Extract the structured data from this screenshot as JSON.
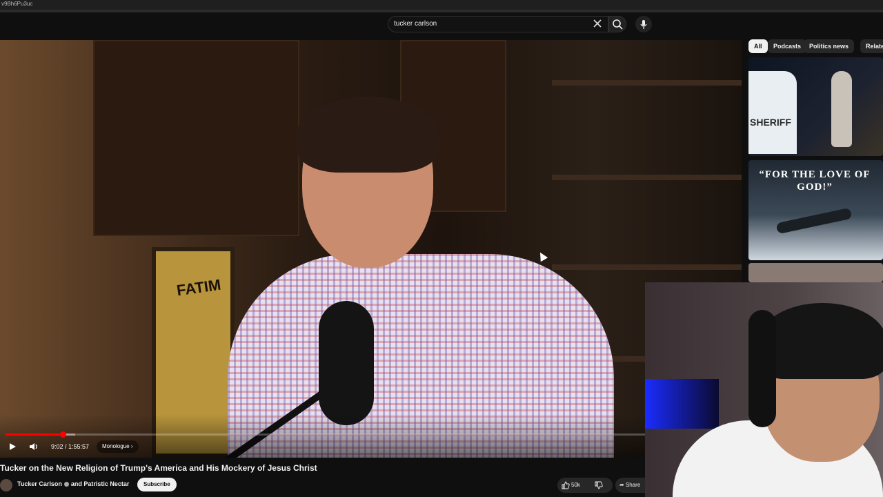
{
  "browser": {
    "url_fragment": "v9Bh6Pu3uc"
  },
  "search": {
    "query": "tucker carlson"
  },
  "player": {
    "time": "9:02 / 1:55:57",
    "chapter": "Monologue",
    "progress_fraction": 0.078,
    "buffer_fraction": 0.095
  },
  "video": {
    "title": "Tucker on the New Religion of Trump's America and His Mockery of Jesus Christ",
    "channel": "Tucker Carlson",
    "collab": "and Patristic Nectar",
    "subscribe_label": "Subscribe",
    "likes": "50k",
    "share_label": "Share"
  },
  "filter_chips": [
    {
      "label": "All",
      "active": true
    },
    {
      "label": "Podcasts",
      "active": false
    },
    {
      "label": "Politics news",
      "active": false
    },
    {
      "label": "Related",
      "active": false
    }
  ],
  "recommendations": [
    {
      "overlay_text": "SHERIFF"
    },
    {
      "overlay_text": "“FOR THE LOVE OF GOD!”"
    },
    {
      "overlay_text": ""
    }
  ],
  "scene": {
    "poster_text": "FATIM"
  },
  "colors": {
    "progress": "#ff0000",
    "background": "#0f0f0f",
    "chip_active": "#f1f1f1"
  },
  "icons": [
    "clear-icon",
    "search-icon",
    "mic-icon",
    "play-icon",
    "volume-icon",
    "chevron-right-icon",
    "thumbs-up-icon",
    "thumbs-down-icon",
    "share-icon",
    "verified-icon"
  ]
}
